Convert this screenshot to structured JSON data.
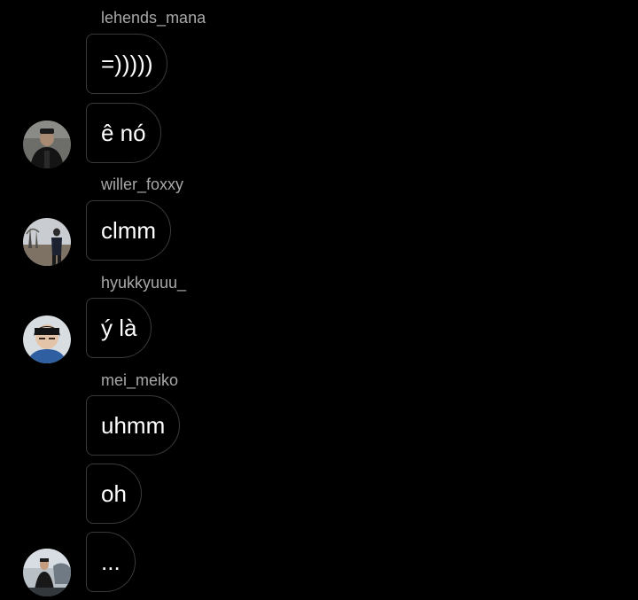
{
  "thread": {
    "groups": [
      {
        "username": "lehends_mana",
        "messages": [
          "=)))))",
          "ê nó"
        ],
        "avatar": "profile-photo-man-dark-jacket"
      },
      {
        "username": "willer_foxxy",
        "messages": [
          "clmm"
        ],
        "avatar": "profile-photo-person-outdoors-trees"
      },
      {
        "username": "hyukkyuuu_",
        "messages": [
          "ý là"
        ],
        "avatar": "profile-photo-young-man-dark-hair"
      },
      {
        "username": "mei_meiko",
        "messages": [
          "uhmm",
          "oh",
          "..."
        ],
        "avatar": "profile-photo-man-car-outdoors"
      }
    ]
  },
  "colors": {
    "background": "#000000",
    "bubble_border": "#3a3a3a",
    "username_text": "#a8a8a8",
    "message_text": "#ffffff"
  }
}
